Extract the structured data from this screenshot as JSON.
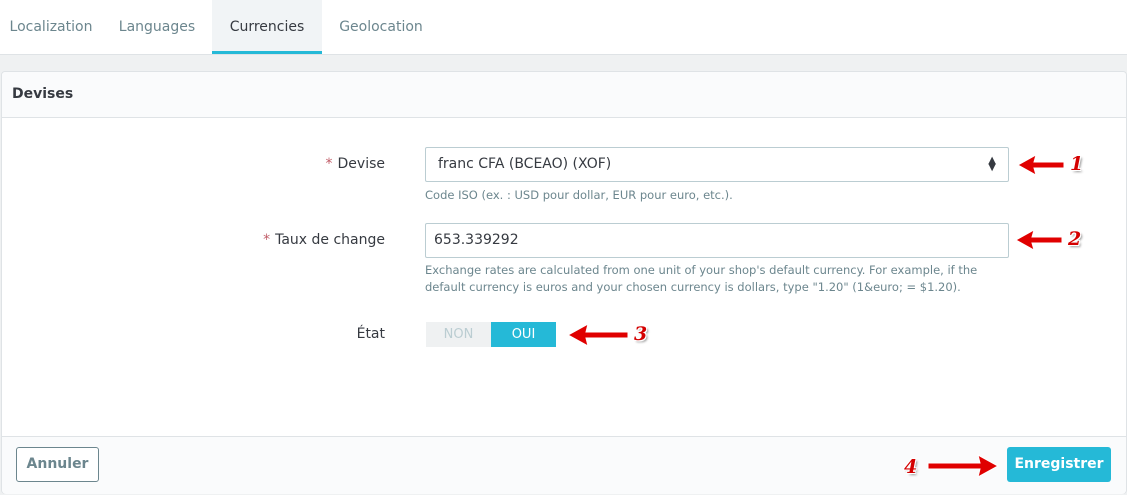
{
  "tabs": [
    {
      "label": "Localization"
    },
    {
      "label": "Languages"
    },
    {
      "label": "Currencies"
    },
    {
      "label": "Geolocation"
    }
  ],
  "panel": {
    "title": "Devises"
  },
  "form": {
    "currency": {
      "required_mark": "*",
      "label": "Devise",
      "value": "franc CFA (BCEAO) (XOF)",
      "help": "Code ISO (ex. : USD pour dollar, EUR pour euro, etc.)."
    },
    "rate": {
      "required_mark": "*",
      "label": "Taux de change",
      "value": "653.339292",
      "help": "Exchange rates are calculated from one unit of your shop's default currency. For example, if the default currency is euros and your chosen currency is dollars, type \"1.20\" (1&euro; = $1.20)."
    },
    "state": {
      "label": "État",
      "off_label": "NON",
      "on_label": "OUI",
      "selected": "OUI"
    }
  },
  "footer": {
    "cancel_label": "Annuler",
    "save_label": "Enregistrer"
  },
  "annotations": [
    {
      "number": "1"
    },
    {
      "number": "2"
    },
    {
      "number": "3"
    },
    {
      "number": "4"
    }
  ],
  "colors": {
    "accent": "#25b9d7",
    "annotation": "#d40000",
    "required": "#c05c67"
  }
}
